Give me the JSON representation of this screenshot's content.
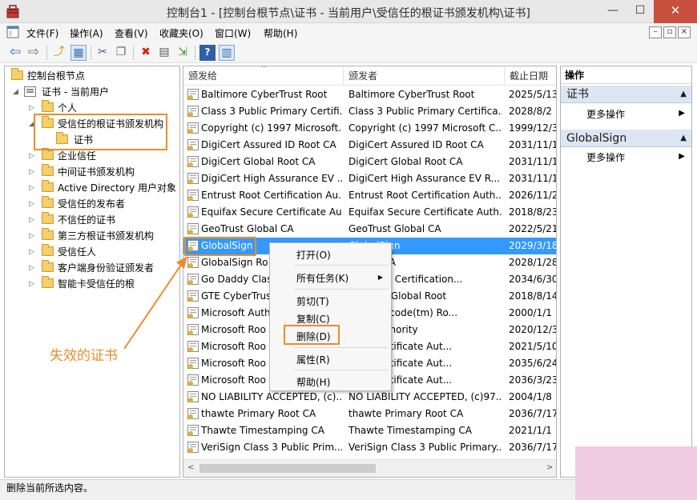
{
  "window": {
    "title": "控制台1 - [控制台根节点\\证书 - 当前用户\\受信任的根证书颁发机构\\证书]",
    "min_glyph": "—",
    "max_glyph": "☐",
    "close_glyph": "✕"
  },
  "menubar": {
    "items": [
      "文件(F)",
      "操作(A)",
      "查看(V)",
      "收藏夹(O)",
      "窗口(W)",
      "帮助(H)"
    ],
    "mdi_min": "–",
    "mdi_restore": "▫",
    "mdi_close": "×"
  },
  "toolbar": {
    "icons": [
      "back-arrow-icon",
      "forward-arrow-icon",
      "up-folder-icon",
      "show-hide-tree-icon",
      "cut-icon",
      "copy-icon",
      "delete-icon",
      "properties-icon",
      "export-list-icon",
      "help-icon",
      "show-hide-action-pane-icon"
    ],
    "glyphs": {
      "back": "⇦",
      "forward": "⇨",
      "up": "⤴",
      "tree": "▦",
      "cut": "✂",
      "copy": "❐",
      "delete": "✖",
      "properties": "▤",
      "export": "⇲",
      "help": "?",
      "action_pane": "▥"
    }
  },
  "tree": {
    "root": "控制台根节点",
    "store": "证书 - 当前用户",
    "children": [
      "个人",
      "受信任的根证书颁发机构",
      "证书",
      "企业信任",
      "中间证书颁发机构",
      "Active Directory 用户对象",
      "受信任的发布者",
      "不信任的证书",
      "第三方根证书颁发机构",
      "受信任人",
      "客户端身份验证颁发者",
      "智能卡受信任的根"
    ],
    "expand_glyph": "▷",
    "collapse_glyph": "◢"
  },
  "list": {
    "columns": [
      "颁发给",
      "颁发者",
      "截止日期"
    ],
    "sort_glyph": "^",
    "rows": [
      {
        "issued_to": "Baltimore CyberTrust Root",
        "issued_by": "Baltimore CyberTrust Root",
        "expires": "2025/5/13"
      },
      {
        "issued_to": "Class 3 Public Primary Certifi...",
        "issued_by": "Class 3 Public Primary Certifica...",
        "expires": "2028/8/2"
      },
      {
        "issued_to": "Copyright (c) 1997 Microsoft...",
        "issued_by": "Copyright (c) 1997 Microsoft C...",
        "expires": "1999/12/3"
      },
      {
        "issued_to": "DigiCert Assured ID Root CA",
        "issued_by": "DigiCert Assured ID Root CA",
        "expires": "2031/11/1"
      },
      {
        "issued_to": "DigiCert Global Root CA",
        "issued_by": "DigiCert Global Root CA",
        "expires": "2031/11/1"
      },
      {
        "issued_to": "DigiCert High Assurance EV ...",
        "issued_by": "DigiCert High Assurance EV R...",
        "expires": "2031/11/1"
      },
      {
        "issued_to": "Entrust Root Certification Au...",
        "issued_by": "Entrust Root Certification Auth...",
        "expires": "2026/11/2"
      },
      {
        "issued_to": "Equifax Secure Certificate Au...",
        "issued_by": "Equifax Secure Certificate Auth...",
        "expires": "2018/8/23"
      },
      {
        "issued_to": "GeoTrust Global CA",
        "issued_by": "GeoTrust Global CA",
        "expires": "2022/5/21"
      },
      {
        "issued_to": "GlobalSign",
        "issued_by": "GlobalSign",
        "expires": "2029/3/18"
      },
      {
        "issued_to": "GlobalSign Ro",
        "issued_by": "n Root CA",
        "expires": "2028/1/28"
      },
      {
        "issued_to": "Go Daddy Clas",
        "issued_by": "y Class 2 Certification...",
        "expires": "2034/6/30"
      },
      {
        "issued_to": "GTE CyberTrus",
        "issued_by": "berTrust Global Root",
        "expires": "2018/8/14"
      },
      {
        "issued_to": "Microsoft Auth",
        "issued_by": "Authenticode(tm) Ro...",
        "expires": "2000/1/1"
      },
      {
        "issued_to": "Microsoft Roo",
        "issued_by": "Root Authority",
        "expires": "2020/12/3"
      },
      {
        "issued_to": "Microsoft Roo",
        "issued_by": "Root Certificate Aut...",
        "expires": "2021/5/10"
      },
      {
        "issued_to": "Microsoft Roo",
        "issued_by": "Root Certificate Aut...",
        "expires": "2035/6/24"
      },
      {
        "issued_to": "Microsoft Roo",
        "issued_by": "Root Certificate Aut...",
        "expires": "2036/3/23"
      },
      {
        "issued_to": "NO LIABILITY ACCEPTED, (c)...",
        "issued_by": "NO LIABILITY ACCEPTED, (c)97...",
        "expires": "2004/1/8"
      },
      {
        "issued_to": "thawte Primary Root CA",
        "issued_by": "thawte Primary Root CA",
        "expires": "2036/7/17"
      },
      {
        "issued_to": "Thawte Timestamping CA",
        "issued_by": "Thawte Timestamping CA",
        "expires": "2021/1/1"
      },
      {
        "issued_to": "VeriSign Class 3 Public Prim...",
        "issued_by": "VeriSign Class 3 Public Primary...",
        "expires": "2036/7/17"
      }
    ],
    "scroll_left": "<",
    "scroll_right": ">"
  },
  "actions": {
    "header": "操作",
    "sections": [
      {
        "title": "证书",
        "item": "更多操作"
      },
      {
        "title": "GlobalSign",
        "item": "更多操作"
      }
    ],
    "collapse_glyph": "▲",
    "submenu_glyph": "▶"
  },
  "context_menu": {
    "items": [
      "打开(O)",
      "所有任务(K)",
      "剪切(T)",
      "复制(C)",
      "删除(D)",
      "属性(R)",
      "帮助(H)"
    ],
    "submenu_glyph": "▶"
  },
  "status": {
    "text": "删除当前所选内容。"
  },
  "annotation": {
    "label": "失效的证书",
    "color": "#ef8b2c"
  },
  "colors": {
    "selection": "#3399ff",
    "action_section": "#dce6f2",
    "close_button": "#c7503f",
    "annotation": "#ef8b2c"
  }
}
